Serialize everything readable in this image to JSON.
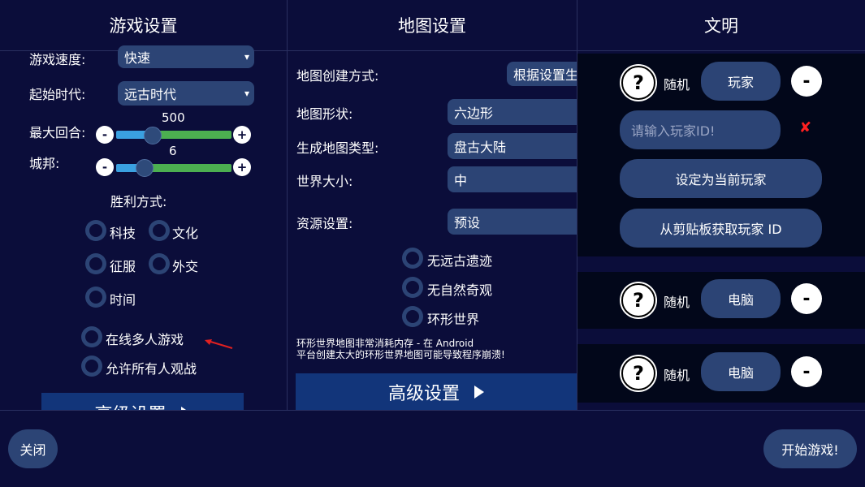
{
  "columns": {
    "game_settings": {
      "title": "游戏设置"
    },
    "map_settings": {
      "title": "地图设置"
    },
    "civilizations": {
      "title": "文明"
    }
  },
  "game": {
    "speed_label": "游戏速度:",
    "speed_value": "快速",
    "era_label": "起始时代:",
    "era_value": "远古时代",
    "max_turns_label": "最大回合:",
    "max_turns_value": "500",
    "city_states_label": "城邦:",
    "city_states_value": "6",
    "victory_title": "胜利方式:",
    "victories": [
      "科技",
      "文化",
      "征服",
      "外交",
      "时间"
    ],
    "online_multiplayer": "在线多人游戏",
    "allow_spectators": "允许所有人观战",
    "advanced": "高级设置"
  },
  "map": {
    "creation_label": "地图创建方式:",
    "creation_value": "根据设置生",
    "shape_label": "地图形状:",
    "shape_value": "六边形",
    "type_label": "生成地图类型:",
    "type_value": "盘古大陆",
    "size_label": "世界大小:",
    "size_value": "中",
    "resource_label": "资源设置:",
    "resource_value": "预设",
    "options": [
      "无远古遗迹",
      "无自然奇观",
      "环形世界"
    ],
    "warning_line1": "环形世界地图非常消耗内存 - 在 Android",
    "warning_line2": "平台创建太大的环形世界地图可能导致程序崩溃!",
    "advanced": "高级设置"
  },
  "civ": {
    "random_label": "随机",
    "player_label": "玩家",
    "computer_label": "电脑",
    "player_id_placeholder": "请输入玩家ID!",
    "set_current": "设定为当前玩家",
    "from_clipboard": "从剪贴板获取玩家 ID"
  },
  "footer": {
    "close": "关闭",
    "start": "开始游戏!"
  },
  "colors": {
    "background": "#0b0d3a",
    "button": "#2c4475",
    "slider_filled": "#3aa0e0",
    "slider_rest": "#4caf50",
    "error": "#ff2020"
  }
}
